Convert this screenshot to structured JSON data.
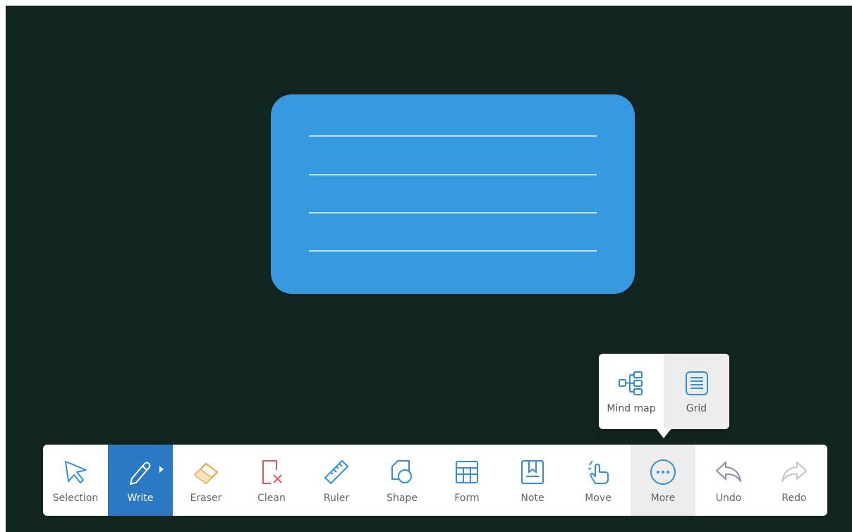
{
  "colors": {
    "board_background": "#12241f",
    "note_card": "#3799e0",
    "active_tool": "#2b78c5"
  },
  "board": {
    "note_card": {
      "line_count": 4
    }
  },
  "more_popup": {
    "items": [
      {
        "label": "Mind map",
        "icon": "mind-map-icon"
      },
      {
        "label": "Grid",
        "icon": "grid-icon"
      }
    ]
  },
  "toolbar": {
    "items": [
      {
        "label": "Selection",
        "icon": "cursor-arrow-icon"
      },
      {
        "label": "Write",
        "icon": "pen-icon",
        "state": "active"
      },
      {
        "label": "Eraser",
        "icon": "eraser-icon"
      },
      {
        "label": "Clean",
        "icon": "clean-page-icon"
      },
      {
        "label": "Ruler",
        "icon": "ruler-icon"
      },
      {
        "label": "Shape",
        "icon": "shape-icon"
      },
      {
        "label": "Form",
        "icon": "table-icon"
      },
      {
        "label": "Note",
        "icon": "note-icon"
      },
      {
        "label": "Move",
        "icon": "hand-move-icon"
      },
      {
        "label": "More",
        "icon": "more-dots-icon",
        "state": "open"
      },
      {
        "label": "Undo",
        "icon": "undo-icon"
      },
      {
        "label": "Redo",
        "icon": "redo-icon",
        "state": "disabled"
      }
    ]
  }
}
